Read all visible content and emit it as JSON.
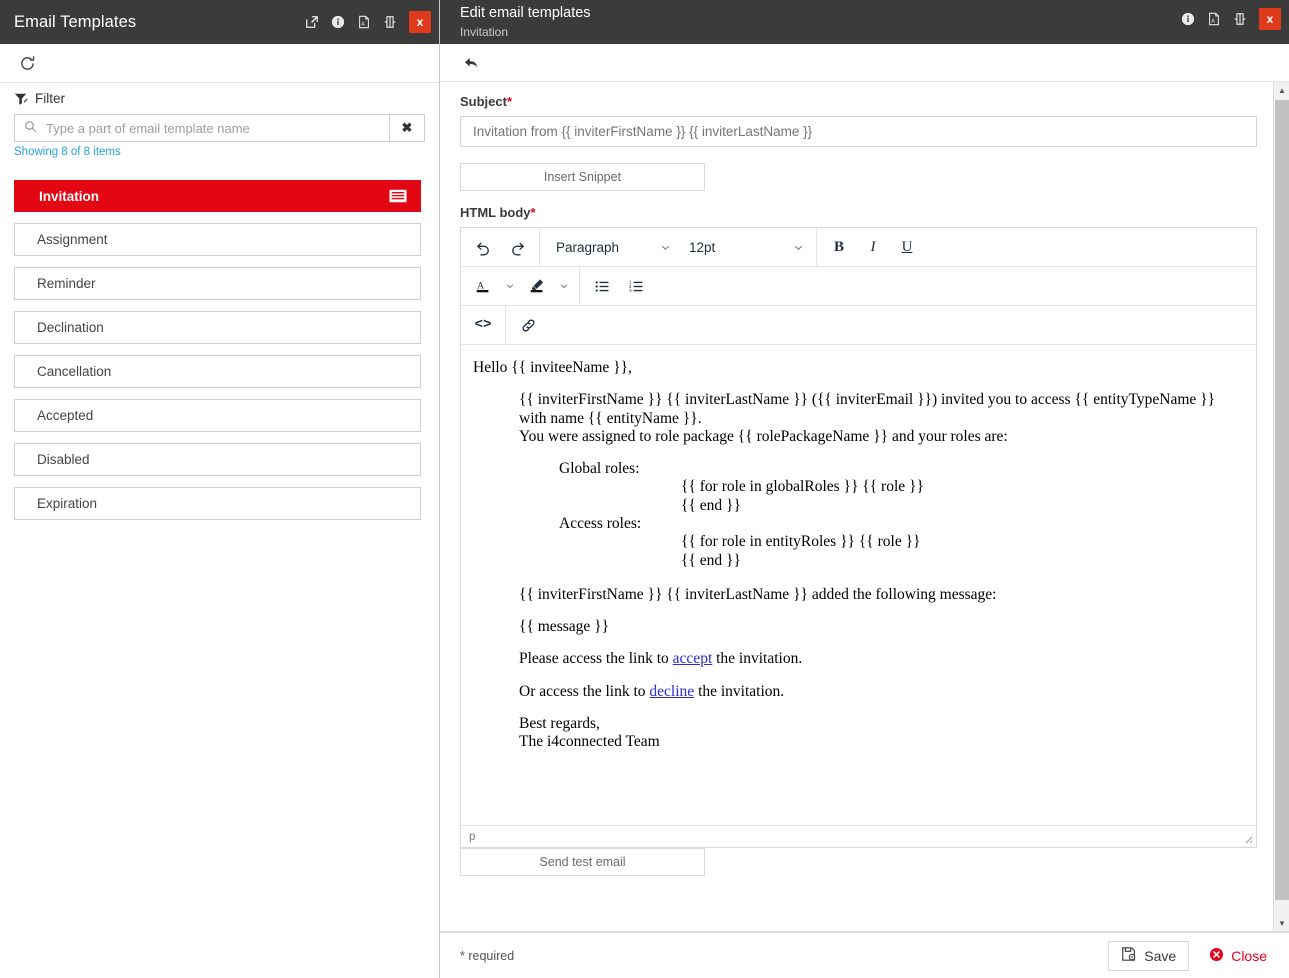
{
  "left_panel": {
    "header": {
      "title": "Email Templates",
      "icons": [
        "popout-icon",
        "info-icon",
        "pdf-icon",
        "dock-icon"
      ],
      "close_label": "x"
    },
    "toolbar": {
      "refresh_label": "refresh-icon"
    },
    "filter": {
      "label": "Filter",
      "placeholder": "Type a part of email template name",
      "value": "",
      "clear_label": "✖",
      "showing": "Showing 8 of 8 items"
    },
    "items": [
      {
        "label": "Invitation",
        "selected": true
      },
      {
        "label": "Assignment",
        "selected": false
      },
      {
        "label": "Reminder",
        "selected": false
      },
      {
        "label": "Declination",
        "selected": false
      },
      {
        "label": "Cancellation",
        "selected": false
      },
      {
        "label": "Accepted",
        "selected": false
      },
      {
        "label": "Disabled",
        "selected": false
      },
      {
        "label": "Expiration",
        "selected": false
      }
    ]
  },
  "right_panel": {
    "header": {
      "title": "Edit email templates",
      "subtitle": "Invitation",
      "icons": [
        "info-icon",
        "pdf-icon",
        "dock-icon"
      ],
      "close_label": "x"
    },
    "subject": {
      "label": "Subject",
      "required_marker": "*",
      "value": "Invitation from {{ inviterFirstName }} {{ inviterLastName }}",
      "placeholder": "Invitation from {{ inviterFirstName }} {{ inviterLastName }}"
    },
    "insert_snippet_label": "Insert Snippet",
    "html_body": {
      "label": "HTML body",
      "required_marker": "*",
      "toolbar": {
        "undo": "undo-icon",
        "redo": "redo-icon",
        "block_format": "Paragraph",
        "font_size": "12pt",
        "bold": "B",
        "italic": "I",
        "underline": "U",
        "text_color": "text-color-icon",
        "highlight_color": "highlight-color-icon",
        "bullet_list": "bullet-list-icon",
        "numbered_list": "numbered-list-icon",
        "source_code": "<>",
        "link": "link-icon"
      },
      "content": {
        "greeting": "Hello {{ inviteeName }},",
        "para_invite_line1": "{{ inviterFirstName }} {{ inviterLastName }} ({{ inviterEmail }}) invited you to access {{ entityTypeName }}",
        "para_invite_line2": "with name {{ entityName }}.",
        "para_invite_line3": "You were assigned to role package {{ rolePackageName }} and your roles are:",
        "global_roles_label": "Global roles:",
        "global_roles_loop": "{{ for role in globalRoles }} {{ role }}",
        "global_roles_end": "{{ end }}",
        "access_roles_label": "Access roles:",
        "access_roles_loop": "{{ for role in entityRoles }} {{ role }}",
        "access_roles_end": "{{ end }}",
        "message_intro": "{{ inviterFirstName }} {{ inviterLastName }} added the following message:",
        "message_var": "{{ message }}",
        "accept_pre": "Please access the link to ",
        "accept_link": "accept",
        "accept_post": " the invitation.",
        "decline_pre": "Or access the link to ",
        "decline_link": "decline",
        "decline_post": " the invitation.",
        "signoff_line1": "Best regards,",
        "signoff_line2": "The i4connected Team"
      },
      "status_path": "p"
    },
    "send_test_email_label": "Send test email",
    "footer": {
      "required_note": "* required",
      "save_label": "Save",
      "close_label": "Close"
    }
  },
  "colors": {
    "header_bg": "#3b3b3b",
    "accent_red": "#e30613",
    "close_red": "#e03a1c",
    "link_blue": "#28a3d8",
    "editor_link": "#2a2ad6"
  }
}
